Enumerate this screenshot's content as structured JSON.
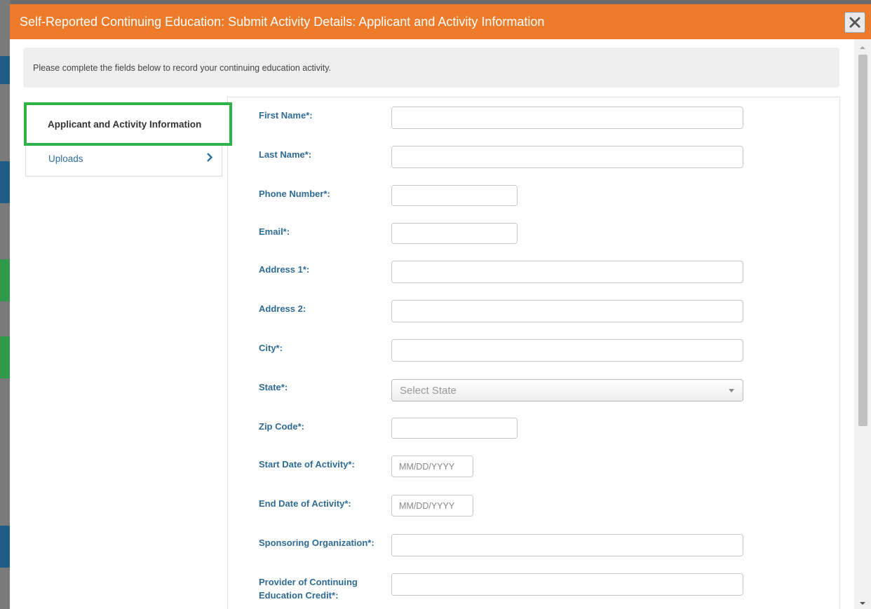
{
  "modal": {
    "title": "Self-Reported Continuing Education: Submit Activity Details: Applicant and Activity Information",
    "instructions": "Please complete the fields below to record your continuing education activity."
  },
  "sidebar": {
    "items": [
      {
        "label": "Applicant and Activity Information",
        "active": true
      },
      {
        "label": "Uploads",
        "active": false
      }
    ]
  },
  "form": {
    "first_name": {
      "label": "First Name*:",
      "value": ""
    },
    "last_name": {
      "label": "Last Name*:",
      "value": ""
    },
    "phone": {
      "label": "Phone Number*:",
      "value": ""
    },
    "email": {
      "label": "Email*:",
      "value": ""
    },
    "address1": {
      "label": "Address 1*:",
      "value": ""
    },
    "address2": {
      "label": "Address 2:",
      "value": ""
    },
    "city": {
      "label": "City*:",
      "value": ""
    },
    "state": {
      "label": "State*:",
      "selected": "Select State"
    },
    "zip": {
      "label": "Zip Code*:",
      "value": ""
    },
    "start_date": {
      "label": "Start Date of Activity*:",
      "placeholder": "MM/DD/YYYY"
    },
    "end_date": {
      "label": "End Date of Activity*:",
      "placeholder": "MM/DD/YYYY"
    },
    "sponsor": {
      "label": "Sponsoring Organization*:",
      "value": ""
    },
    "provider": {
      "label_line1": "Provider of Continuing",
      "label_line2": "Education Credit*:",
      "value": ""
    }
  },
  "colors": {
    "titlebar": "#ee7b2a",
    "label": "#2e6b95",
    "active_outline": "#2fb24a",
    "link": "#2b6f9e"
  },
  "icons": {
    "close": "close-icon",
    "chevron": "chevron-right-icon",
    "caret": "caret-down-icon"
  }
}
